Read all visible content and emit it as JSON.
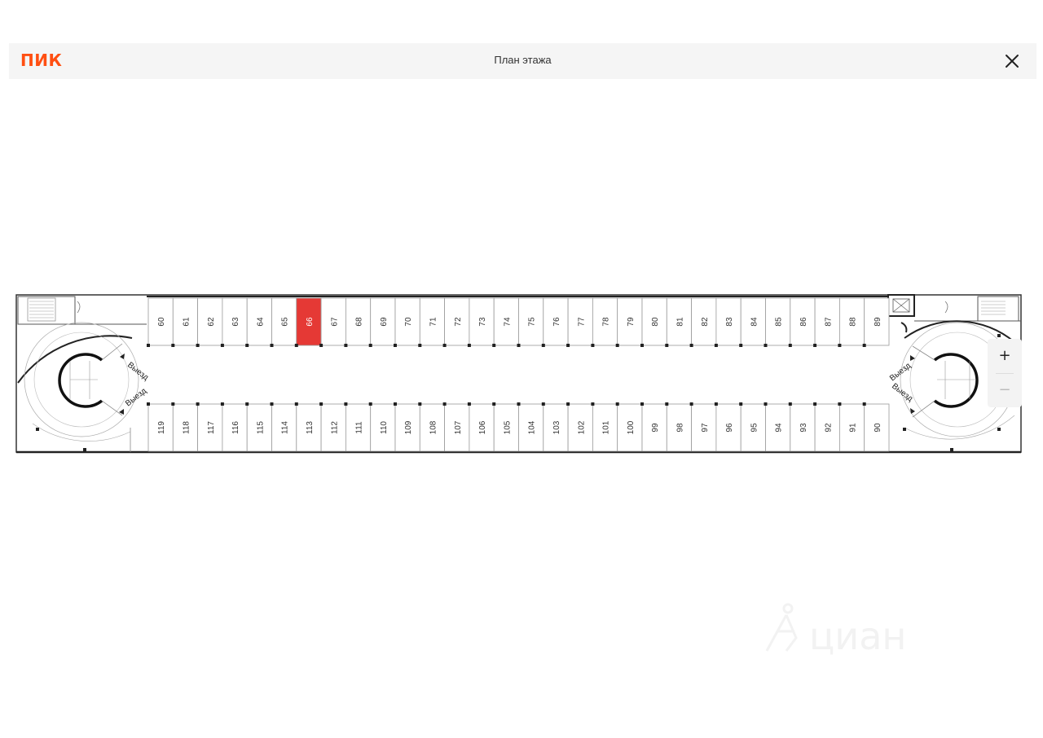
{
  "header": {
    "logo": "ПИК",
    "title": "План этажа"
  },
  "plan": {
    "exit_label": "Выезд",
    "top_row": [
      "60",
      "61",
      "62",
      "63",
      "64",
      "65",
      "66",
      "67",
      "68",
      "69",
      "70",
      "71",
      "72",
      "73",
      "74",
      "75",
      "76",
      "77",
      "78",
      "79",
      "80",
      "81",
      "82",
      "83",
      "84",
      "85",
      "86",
      "87",
      "88",
      "89"
    ],
    "bottom_row": [
      "119",
      "118",
      "117",
      "116",
      "115",
      "114",
      "113",
      "112",
      "111",
      "110",
      "109",
      "108",
      "107",
      "106",
      "105",
      "104",
      "103",
      "102",
      "101",
      "100",
      "99",
      "98",
      "97",
      "96",
      "95",
      "94",
      "93",
      "92",
      "91",
      "90"
    ],
    "selected": "66",
    "selected_color": "#e53935"
  },
  "zoom": {
    "plus": "+",
    "minus": "−"
  },
  "watermark": {
    "text": "циан"
  },
  "colors": {
    "brand": "#ff4f12",
    "header_bg": "#f5f5f5"
  }
}
